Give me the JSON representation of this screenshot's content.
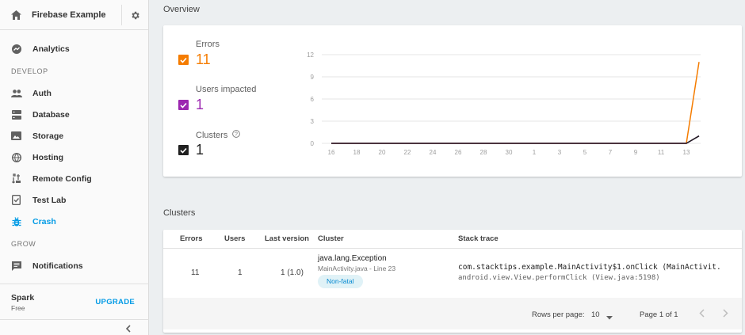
{
  "sidebar": {
    "project_name": "Firebase Example",
    "analytics": "Analytics",
    "develop_label": "DEVELOP",
    "develop_items": [
      "Auth",
      "Database",
      "Storage",
      "Hosting",
      "Remote Config",
      "Test Lab",
      "Crash"
    ],
    "grow_label": "GROW",
    "grow_items": [
      "Notifications"
    ],
    "plan_name": "Spark",
    "plan_tier": "Free",
    "upgrade": "UPGRADE"
  },
  "overview": {
    "title": "Overview",
    "metrics": [
      {
        "label": "Errors",
        "value": "11",
        "color": "#f57c00"
      },
      {
        "label": "Users impacted",
        "value": "1",
        "color": "#9c27b0"
      },
      {
        "label": "Clusters",
        "value": "1",
        "color": "#212121"
      }
    ]
  },
  "chart_data": {
    "type": "line",
    "x": [
      "16",
      "18",
      "20",
      "22",
      "24",
      "26",
      "28",
      "30",
      "1",
      "3",
      "5",
      "7",
      "9",
      "11",
      "13"
    ],
    "yticks": [
      "12",
      "9",
      "6",
      "3",
      "0"
    ],
    "ylim": [
      0,
      12
    ],
    "series": [
      {
        "color": "#f57c00",
        "points": [
          [
            0,
            0
          ],
          [
            14,
            0
          ],
          [
            14.5,
            11
          ]
        ]
      },
      {
        "color": "#9c27b0",
        "points": [
          [
            0,
            0
          ],
          [
            14,
            0
          ],
          [
            14.5,
            1
          ]
        ]
      },
      {
        "color": "#212121",
        "points": [
          [
            0,
            0
          ],
          [
            14,
            0
          ],
          [
            14.5,
            1
          ]
        ]
      }
    ]
  },
  "clusters": {
    "title": "Clusters",
    "headers": {
      "errors": "Errors",
      "users": "Users",
      "last_version": "Last version",
      "cluster": "Cluster",
      "stack_trace": "Stack trace"
    },
    "row": {
      "errors": "11",
      "users": "1",
      "last_version": "1 (1.0)",
      "exception": "java.lang.Exception",
      "file": "MainActivity.java - Line 23",
      "tag": "Non-fatal",
      "trace1": "com.stacktips.example.MainActivity$1.onClick (MainActivit.",
      "trace2": "android.view.View.performClick (View.java:5198)"
    },
    "footer": {
      "rows_label": "Rows per page:",
      "rows_value": "10",
      "page": "Page 1 of 1"
    }
  }
}
